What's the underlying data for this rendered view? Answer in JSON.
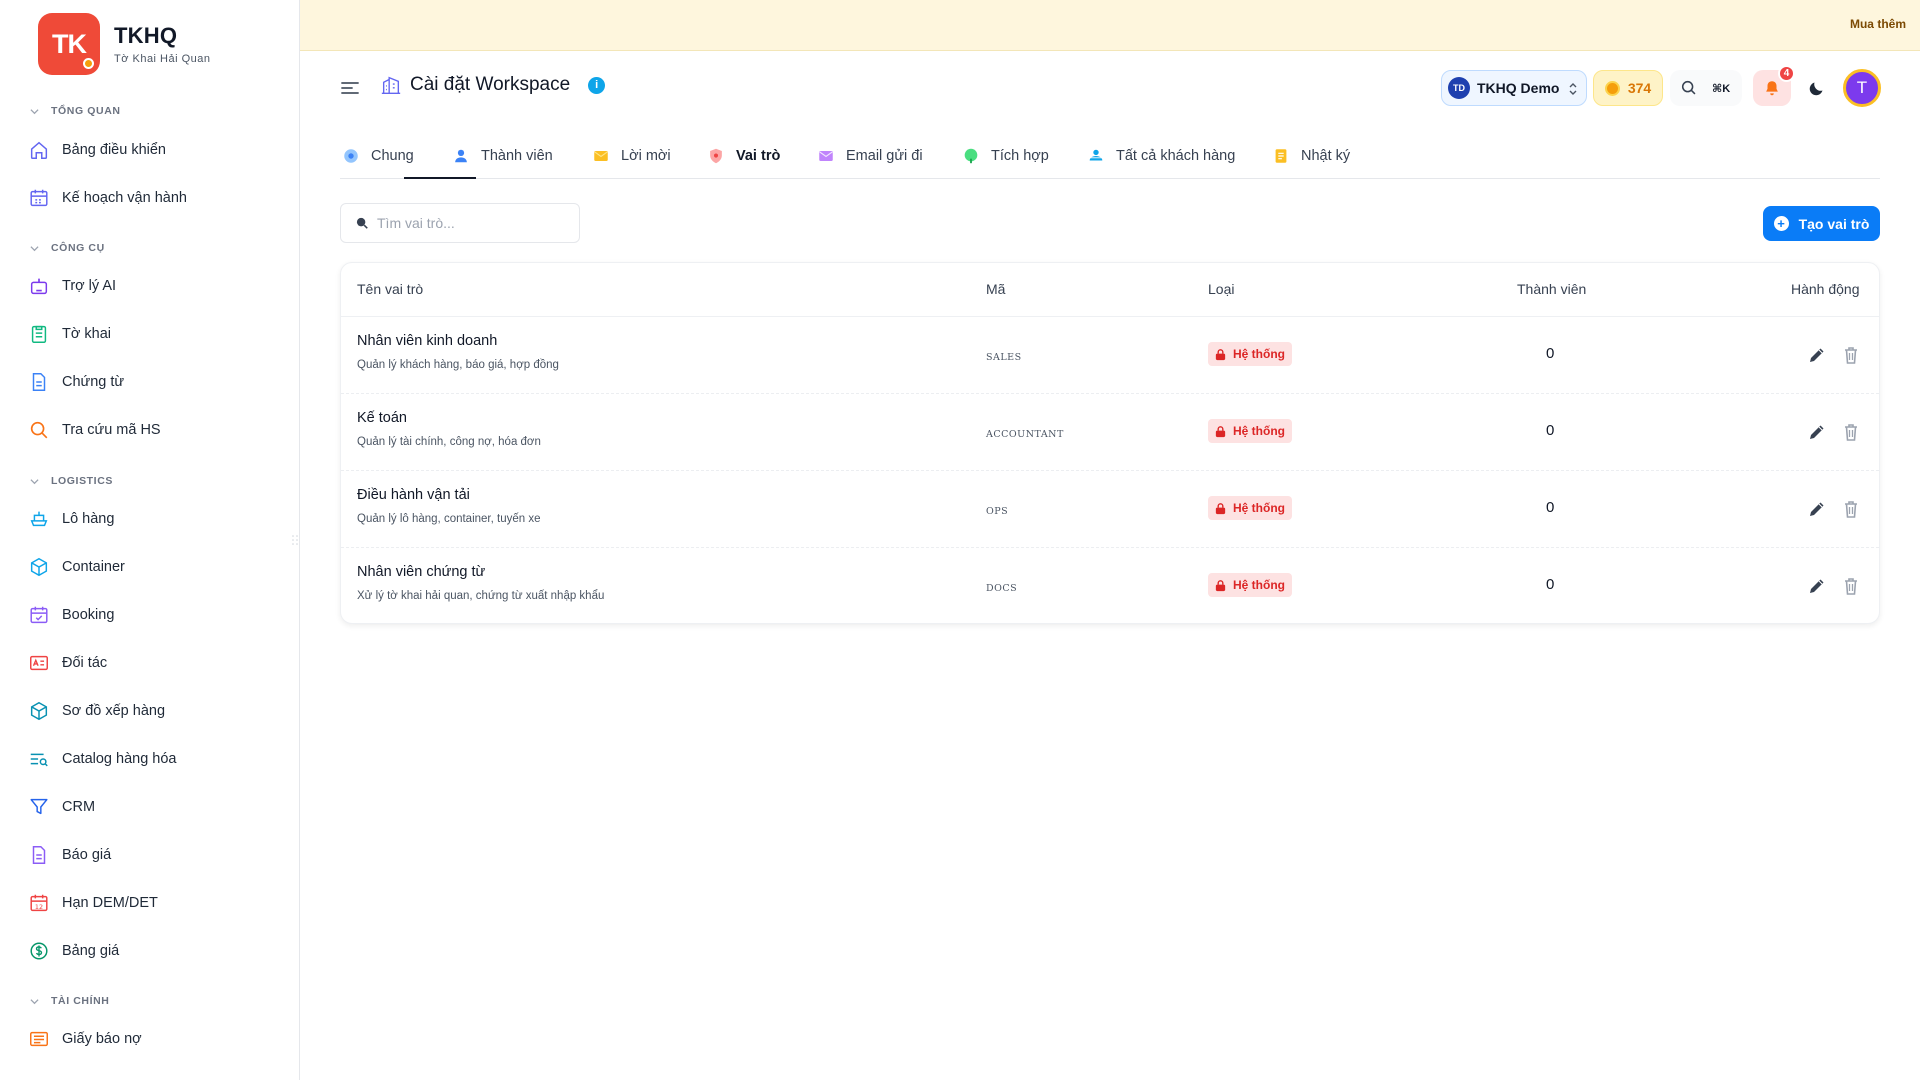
{
  "brand": {
    "name": "TKHQ",
    "subtitle": "Tờ Khai Hải Quan",
    "logo_text": "TK",
    "color": "#ef4a38"
  },
  "banner": {
    "buy_label": "Mua thêm"
  },
  "sidebar": {
    "sections": [
      {
        "label": "TỔNG QUAN",
        "items": [
          {
            "label": "Bảng điều khiển",
            "icon": "home-icon"
          },
          {
            "label": "Kế hoạch vận hành",
            "icon": "calendar-grid-icon"
          }
        ]
      },
      {
        "label": "CÔNG CỤ",
        "items": [
          {
            "label": "Trợ lý AI",
            "icon": "robot-icon"
          },
          {
            "label": "Tờ khai",
            "icon": "clipboard-icon"
          },
          {
            "label": "Chứng từ",
            "icon": "document-icon"
          },
          {
            "label": "Tra cứu mã HS",
            "icon": "search-icon"
          }
        ]
      },
      {
        "label": "LOGISTICS",
        "items": [
          {
            "label": "Lô hàng",
            "icon": "ship-icon"
          },
          {
            "label": "Container",
            "icon": "box-icon"
          },
          {
            "label": "Booking",
            "icon": "calendar-check-icon"
          },
          {
            "label": "Đối tác",
            "icon": "id-card-icon"
          },
          {
            "label": "Sơ đồ xếp hàng",
            "icon": "cube-icon"
          },
          {
            "label": "Catalog hàng hóa",
            "icon": "list-search-icon"
          },
          {
            "label": "CRM",
            "icon": "funnel-icon"
          },
          {
            "label": "Báo giá",
            "icon": "quote-document-icon"
          },
          {
            "label": "Hạn DEM/DET",
            "icon": "calendar-12-icon"
          },
          {
            "label": "Bảng giá",
            "icon": "dollar-icon"
          }
        ]
      },
      {
        "label": "TÀI CHÍNH",
        "items": [
          {
            "label": "Giấy báo nợ",
            "icon": "receipt-icon"
          }
        ]
      }
    ]
  },
  "header": {
    "title": "Cài đặt Workspace",
    "info": "i",
    "workspace": {
      "initials": "TD",
      "name": "TKHQ Demo"
    },
    "credits": "374",
    "shortcut": "⌘K",
    "notifications": "4",
    "user_initial": "T"
  },
  "tabs": [
    {
      "label": "Chung",
      "icon": "gear-icon"
    },
    {
      "label": "Thành viên",
      "icon": "user-icon"
    },
    {
      "label": "Lời mời",
      "icon": "envelope-icon"
    },
    {
      "label": "Vai trò",
      "icon": "shield-icon",
      "active": true
    },
    {
      "label": "Email gửi đi",
      "icon": "mail-icon"
    },
    {
      "label": "Tích hợp",
      "icon": "plug-icon"
    },
    {
      "label": "Tất cả khách hàng",
      "icon": "users-icon"
    },
    {
      "label": "Nhật ký",
      "icon": "notebook-icon"
    }
  ],
  "toolbar": {
    "search_placeholder": "Tìm vai trò...",
    "create_label": "Tạo vai trò"
  },
  "table": {
    "headers": {
      "name": "Tên vai trò",
      "code": "Mã",
      "type": "Loại",
      "members": "Thành viên",
      "actions": "Hành động"
    },
    "rows": [
      {
        "name": "Nhân viên kinh doanh",
        "desc": "Quản lý khách hàng, báo giá, hợp đồng",
        "code": "SALES",
        "type": "Hệ thống",
        "members": "0"
      },
      {
        "name": "Kế toán",
        "desc": "Quản lý tài chính, công nợ, hóa đơn",
        "code": "ACCOUNTANT",
        "type": "Hệ thống",
        "members": "0"
      },
      {
        "name": "Điều hành vận tải",
        "desc": "Quản lý lô hàng, container, tuyến xe",
        "code": "OPS",
        "type": "Hệ thống",
        "members": "0"
      },
      {
        "name": "Nhân viên chứng từ",
        "desc": "Xử lý tờ khai hải quan, chứng từ xuất nhập khẩu",
        "code": "DOCS",
        "type": "Hệ thống",
        "members": "0"
      }
    ]
  },
  "colors": {
    "accent": "#0a7cf7",
    "danger": "#dc2626",
    "banner": "#fef6dd"
  }
}
